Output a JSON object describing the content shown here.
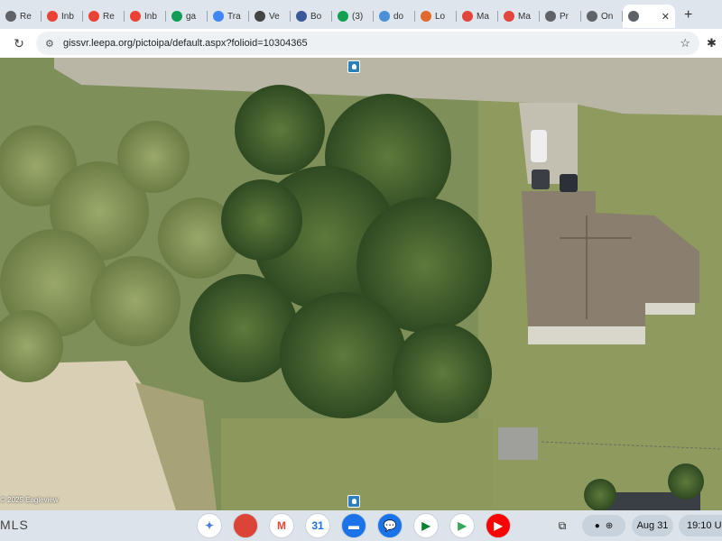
{
  "tabs": [
    {
      "label": "Re",
      "icon": "page-icon",
      "color": "#5f6368"
    },
    {
      "label": "Inb",
      "icon": "gmail-icon",
      "color": "#ea4335"
    },
    {
      "label": "Re",
      "icon": "gmail-icon",
      "color": "#ea4335"
    },
    {
      "label": "Inb",
      "icon": "gmail-icon",
      "color": "#ea4335"
    },
    {
      "label": "ga",
      "icon": "sheets-plus-icon",
      "color": "#0f9d58"
    },
    {
      "label": "Tra",
      "icon": "translate-icon",
      "color": "#4285f4"
    },
    {
      "label": "Ve",
      "icon": "at-icon",
      "color": "#444444"
    },
    {
      "label": "Bo",
      "icon": "blue-sphere-icon",
      "color": "#3b5998"
    },
    {
      "label": "(3)",
      "icon": "green-circle-icon",
      "color": "#12a150"
    },
    {
      "label": "do",
      "icon": "smile-icon",
      "color": "#4a90d9"
    },
    {
      "label": "Lo",
      "icon": "box-icon",
      "color": "#e06a2b"
    },
    {
      "label": "Ma",
      "icon": "red-c-icon",
      "color": "#e2453c"
    },
    {
      "label": "Ma",
      "icon": "red-c-icon",
      "color": "#e2453c"
    },
    {
      "label": "Pr",
      "icon": "globe-icon",
      "color": "#5f6368"
    },
    {
      "label": "On",
      "icon": "globe-icon",
      "color": "#5f6368"
    }
  ],
  "active_tab": {
    "icon": "globe-icon",
    "close": "✕"
  },
  "new_tab": "+",
  "url": "gissvr.leepa.org/pictoipa/default.aspx?folioid=10304365",
  "map": {
    "copyright": "© 2025 Eagleview"
  },
  "shelf": {
    "left_label": "MLS",
    "apps": [
      {
        "name": "gemini-icon",
        "color": "#ffffff",
        "glyph": "✦",
        "fg": "#4a7ce0"
      },
      {
        "name": "chrome-icon",
        "color": "#db4437",
        "glyph": "",
        "fg": "#fff"
      },
      {
        "name": "gmail-icon",
        "color": "#ffffff",
        "glyph": "M",
        "fg": "#ea4335"
      },
      {
        "name": "calendar-icon",
        "color": "#ffffff",
        "glyph": "31",
        "fg": "#1a73e8"
      },
      {
        "name": "files-icon",
        "color": "#1a73e8",
        "glyph": "▬",
        "fg": "#fff"
      },
      {
        "name": "messages-icon",
        "color": "#1a73e8",
        "glyph": "💬",
        "fg": "#fff"
      },
      {
        "name": "meet-icon",
        "color": "#ffffff",
        "glyph": "▶",
        "fg": "#00832d"
      },
      {
        "name": "play-store-icon",
        "color": "#ffffff",
        "glyph": "▶",
        "fg": "#34a853"
      },
      {
        "name": "youtube-icon",
        "color": "#ff0000",
        "glyph": "▶",
        "fg": "#fff"
      }
    ],
    "date": "Aug 31",
    "time": "19:10",
    "time_suffix": "U"
  }
}
